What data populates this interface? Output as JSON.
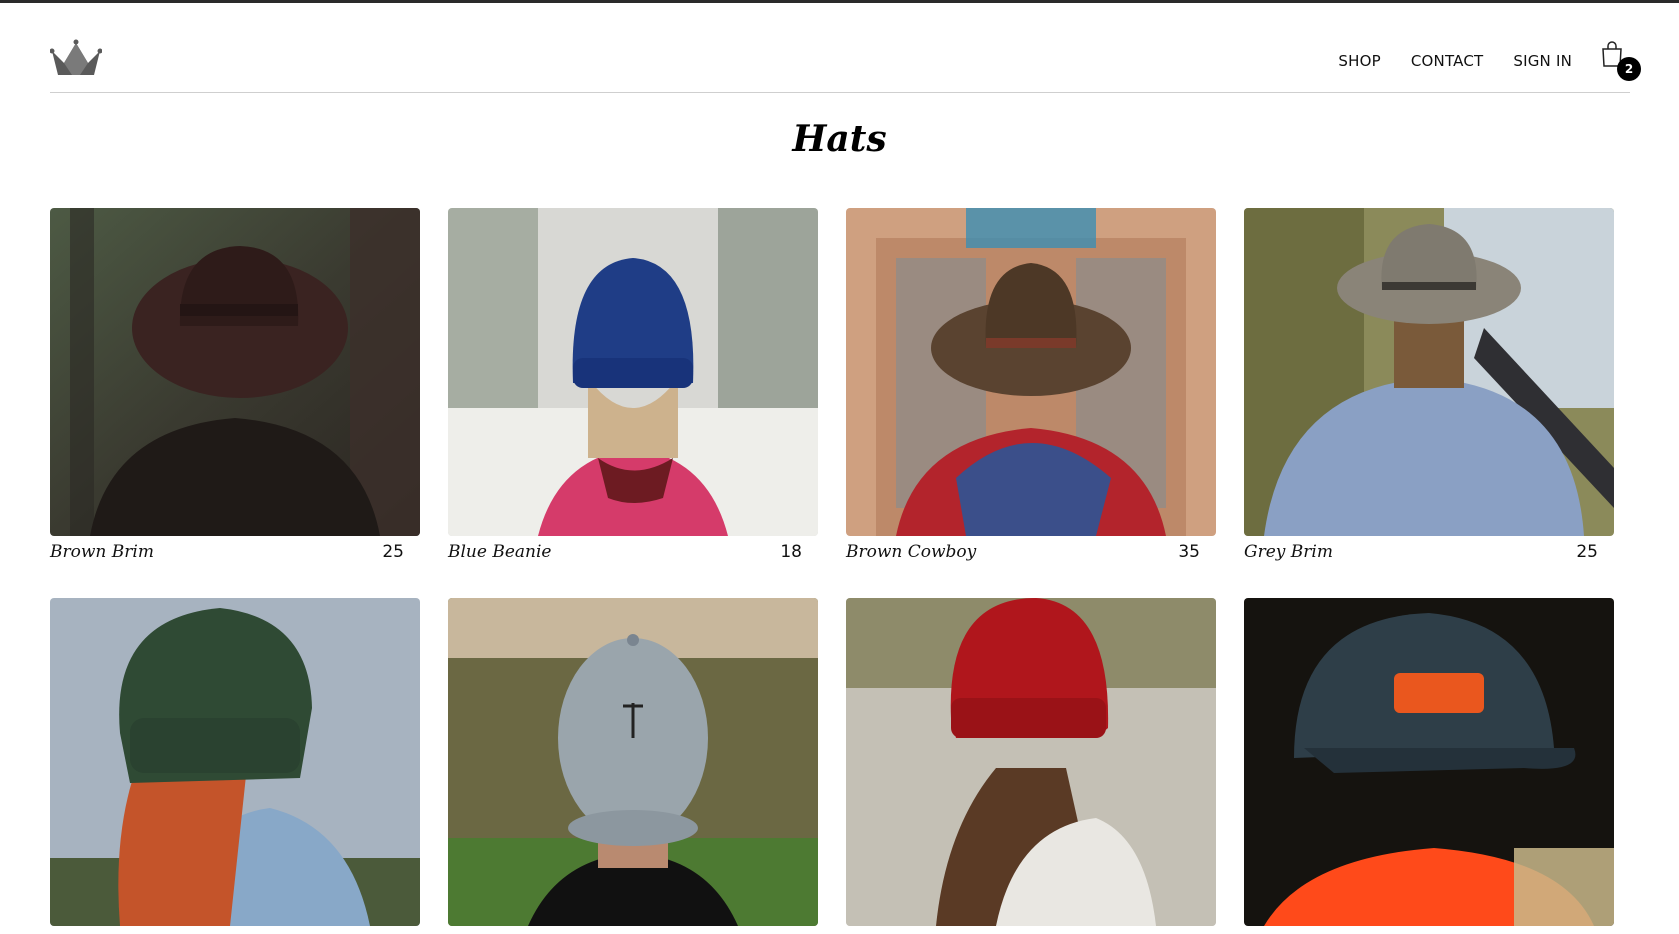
{
  "nav": {
    "items": [
      "SHOP",
      "CONTACT",
      "SIGN IN"
    ],
    "cart_count": "2"
  },
  "page": {
    "title": "Hats"
  },
  "products": [
    {
      "name": "Brown Brim",
      "price": "25"
    },
    {
      "name": "Blue Beanie",
      "price": "18"
    },
    {
      "name": "Brown Cowboy",
      "price": "35"
    },
    {
      "name": "Grey Brim",
      "price": "25"
    },
    {
      "name": "",
      "price": ""
    },
    {
      "name": "",
      "price": ""
    },
    {
      "name": "",
      "price": ""
    },
    {
      "name": "",
      "price": ""
    }
  ],
  "colors": {
    "text": "#111111",
    "badge": "#000000",
    "divider": "#cfcfcf",
    "logo": "#5a5a5a"
  }
}
